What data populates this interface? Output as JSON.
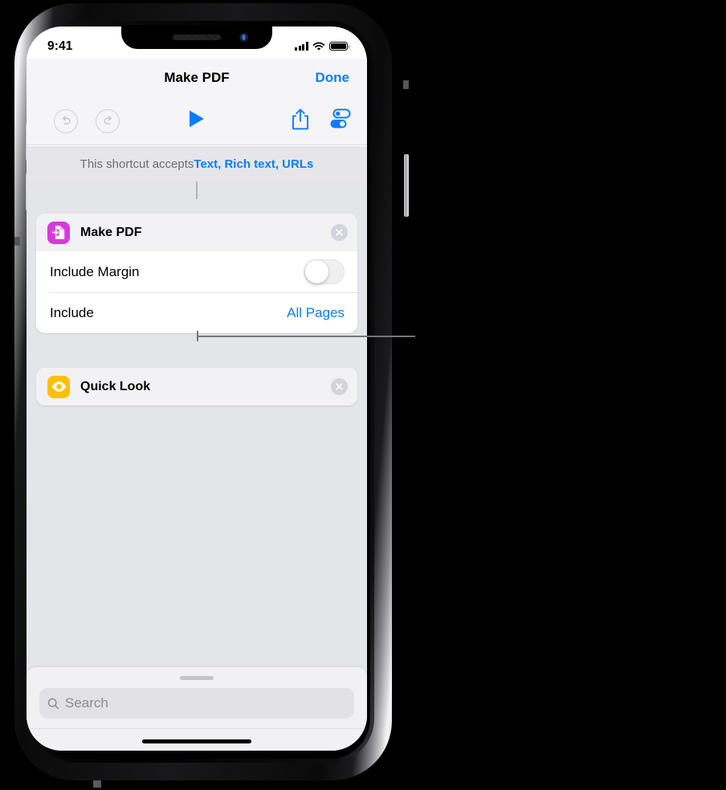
{
  "device": {
    "name": "iphone-x",
    "orientation": "portrait"
  },
  "status_bar": {
    "time": "9:41",
    "cellular_icon": "cellular-signal-icon",
    "wifi_icon": "wifi-icon",
    "battery_icon": "battery-full-icon"
  },
  "nav_bar": {
    "title": "Make PDF",
    "done_label": "Done"
  },
  "toolbar": {
    "undo_icon": "undo-icon",
    "redo_icon": "redo-icon",
    "play_icon": "play-icon",
    "share_icon": "share-icon",
    "settings_icon": "settings-sliders-icon"
  },
  "accepts_bar": {
    "prefix": "This shortcut accepts ",
    "types": "Text, Rich text, URLs"
  },
  "actions": [
    {
      "id": "make-pdf",
      "title": "Make PDF",
      "icon": "make-pdf-document-icon",
      "icon_color": "#d83ad8",
      "close_icon": "close-circle-icon",
      "parameters": [
        {
          "label": "Include Margin",
          "type": "switch",
          "value": "off"
        },
        {
          "label": "Include",
          "type": "value",
          "value": "All Pages"
        }
      ]
    },
    {
      "id": "quick-look",
      "title": "Quick Look",
      "icon": "quick-look-eye-icon",
      "icon_color": "#fdc000",
      "close_icon": "close-circle-icon",
      "parameters": []
    }
  ],
  "bottom_sheet": {
    "grabber": "sheet-grabber",
    "search": {
      "icon": "search-icon",
      "placeholder": "Search",
      "value": ""
    }
  },
  "home_indicator": "home-indicator",
  "colors": {
    "accent_blue": "#0a7cff",
    "canvas_bg": "#e4e5e9",
    "bar_bg": "#f5f5f7",
    "accepts_bg": "#e6e6ea",
    "callout": "#76767a"
  },
  "callout": {
    "name": "action-output-callout-line",
    "description": "Leader line pointing from between the Make PDF and Quick Look actions to the right edge"
  }
}
